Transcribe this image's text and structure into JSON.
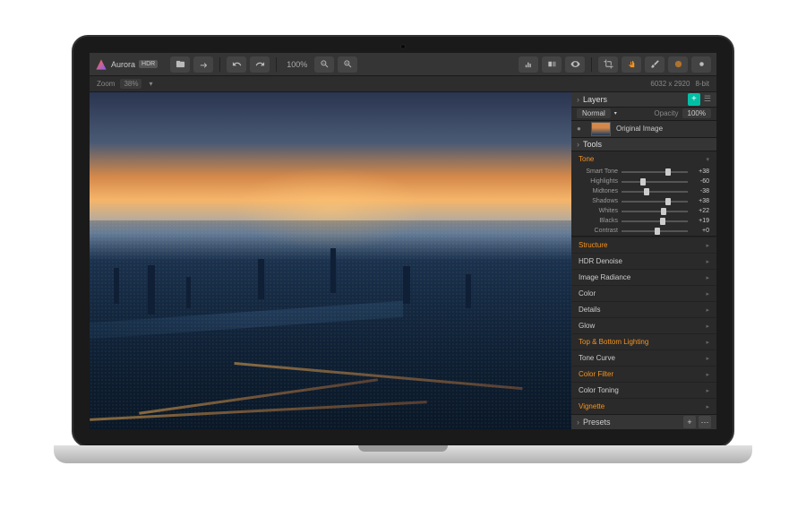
{
  "app": {
    "name": "Aurora",
    "badge": "HDR"
  },
  "toolbar": {
    "zoom_fit_label": "100%",
    "zoom_label": "Zoom",
    "zoom_value": "38%"
  },
  "statusbar": {
    "dimensions": "6032 x 2920",
    "bitdepth": "8-bit"
  },
  "layers": {
    "title": "Layers",
    "blend_mode": "Normal",
    "opacity_label": "Opacity",
    "opacity_value": "100%",
    "items": [
      {
        "name": "Original Image"
      }
    ]
  },
  "tools": {
    "title": "Tools",
    "tone": {
      "title": "Tone",
      "sliders": [
        {
          "label": "Smart Tone",
          "value": 38,
          "pos": 66
        },
        {
          "label": "Highlights",
          "value": -60,
          "pos": 28
        },
        {
          "label": "Midtones",
          "value": -38,
          "pos": 34
        },
        {
          "label": "Shadows",
          "value": 38,
          "pos": 66
        },
        {
          "label": "Whites",
          "value": 22,
          "pos": 60
        },
        {
          "label": "Blacks",
          "value": 19,
          "pos": 58
        },
        {
          "label": "Contrast",
          "value": 0,
          "pos": 50
        }
      ]
    },
    "sections": [
      {
        "label": "Structure",
        "accent": true
      },
      {
        "label": "HDR Denoise",
        "accent": false
      },
      {
        "label": "Image Radiance",
        "accent": false
      },
      {
        "label": "Color",
        "accent": false
      },
      {
        "label": "Details",
        "accent": false
      },
      {
        "label": "Glow",
        "accent": false
      },
      {
        "label": "Top & Bottom Lighting",
        "accent": true
      },
      {
        "label": "Tone Curve",
        "accent": false
      },
      {
        "label": "Color Filter",
        "accent": true
      },
      {
        "label": "Color Toning",
        "accent": false
      },
      {
        "label": "Vignette",
        "accent": true
      }
    ]
  },
  "presets": {
    "title": "Presets"
  }
}
